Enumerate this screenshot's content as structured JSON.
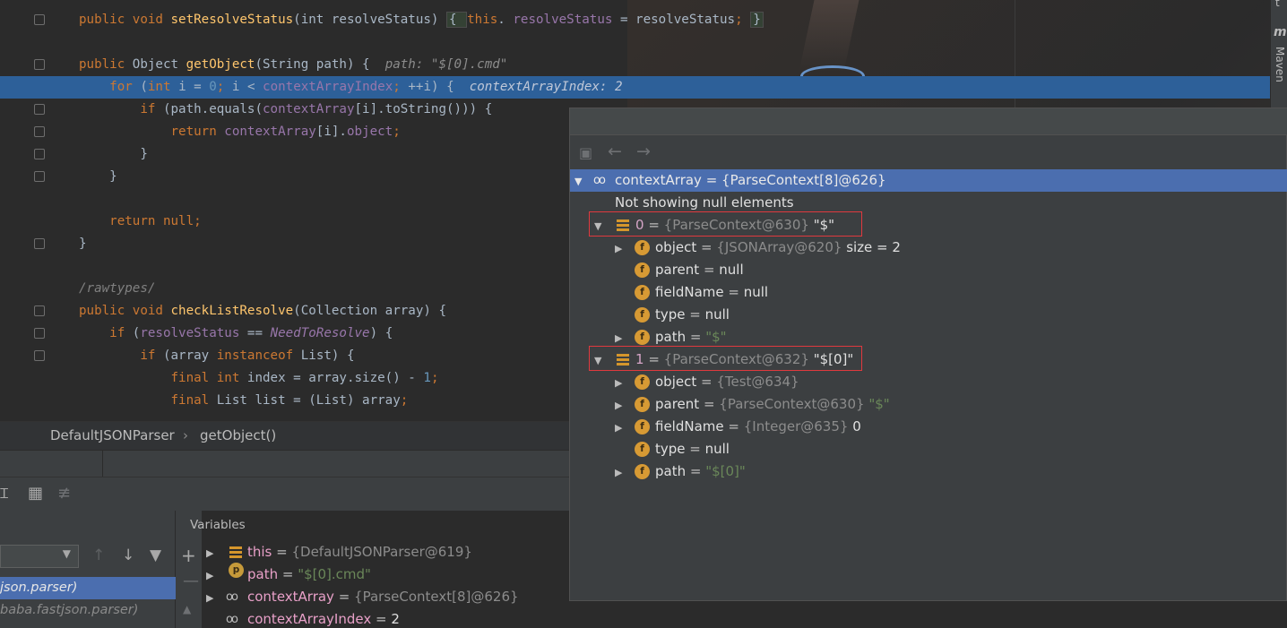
{
  "editor": {
    "lines": [
      {
        "id": "l1",
        "parts": [
          [
            "kw",
            "public void "
          ],
          [
            "fn",
            "setResolveStatus"
          ],
          [
            "",
            "(int resolveStatus) "
          ],
          [
            "annot",
            "{ "
          ],
          [
            "kw",
            "this"
          ],
          [
            "",
            ". "
          ],
          [
            "fld",
            "resolveStatus"
          ],
          [
            "",
            " = resolveStatus"
          ],
          [
            "kw",
            "; "
          ],
          [
            "annot",
            "}"
          ]
        ]
      },
      {
        "id": "l3",
        "parts": [
          [
            "kw",
            "public "
          ],
          [
            "",
            "Object "
          ],
          [
            "fn",
            "getObject"
          ],
          [
            "",
            "(String path) {  "
          ],
          [
            "hint",
            "path: \"$[0].cmd\""
          ]
        ]
      },
      {
        "id": "l4",
        "parts": [
          [
            "kw",
            "    for "
          ],
          [
            "",
            "("
          ],
          [
            "kw",
            "int "
          ],
          [
            "",
            "i = "
          ],
          [
            "num",
            "0"
          ],
          [
            "kw",
            "; "
          ],
          [
            "",
            "i < "
          ],
          [
            "fld",
            "contextArrayIndex"
          ],
          [
            "kw",
            "; "
          ],
          [
            "",
            "++i) {  "
          ],
          [
            "hint",
            "contextArrayIndex: 2"
          ]
        ]
      },
      {
        "id": "l5",
        "parts": [
          [
            "kw",
            "        if "
          ],
          [
            "",
            "(path.equals("
          ],
          [
            "fld",
            "contextArray"
          ],
          [
            "",
            "[i].toString())) {"
          ]
        ]
      },
      {
        "id": "l6",
        "parts": [
          [
            "kw",
            "            return "
          ],
          [
            "fld",
            "contextArray"
          ],
          [
            "",
            "[i]."
          ],
          [
            "fld",
            "object"
          ],
          [
            "kw",
            ";"
          ]
        ]
      },
      {
        "id": "l7",
        "parts": [
          [
            "",
            "        }"
          ]
        ]
      },
      {
        "id": "l8",
        "parts": [
          [
            "",
            "    }"
          ]
        ]
      },
      {
        "id": "l10",
        "parts": [
          [
            "kw",
            "    return null;"
          ]
        ]
      },
      {
        "id": "l11",
        "parts": [
          [
            "",
            "}"
          ]
        ]
      },
      {
        "id": "l13",
        "parts": [
          [
            "cm",
            "/rawtypes/"
          ]
        ]
      },
      {
        "id": "l14",
        "parts": [
          [
            "kw",
            "public void "
          ],
          [
            "fn",
            "checkListResolve"
          ],
          [
            "",
            "(Collection array) {"
          ]
        ]
      },
      {
        "id": "l15",
        "parts": [
          [
            "kw",
            "    if "
          ],
          [
            "",
            "("
          ],
          [
            "fld",
            "resolveStatus"
          ],
          [
            "",
            " == "
          ],
          [
            "st",
            "NeedToResolve"
          ],
          [
            "",
            ") {"
          ]
        ]
      },
      {
        "id": "l16",
        "parts": [
          [
            "kw",
            "        if "
          ],
          [
            "",
            "(array "
          ],
          [
            "kw",
            "instanceof "
          ],
          [
            "",
            "List) {"
          ]
        ]
      },
      {
        "id": "l17",
        "parts": [
          [
            "kw",
            "            final int "
          ],
          [
            "",
            "index = array.size() - "
          ],
          [
            "num",
            "1"
          ],
          [
            "kw",
            ";"
          ]
        ]
      },
      {
        "id": "l18",
        "parts": [
          [
            "kw",
            "            final "
          ],
          [
            "",
            "List list = (List) array"
          ],
          [
            "kw",
            ";"
          ]
        ]
      }
    ]
  },
  "breadcrumb": {
    "class_name": "DefaultJSONParser",
    "separator": "›",
    "method_name": "getObject()"
  },
  "frames": {
    "rows": [
      "json.parser)",
      "baba.fastjson.parser)"
    ]
  },
  "variables": {
    "title": "Variables",
    "rows": [
      {
        "name": "this",
        "value": "{DefaultJSONParser@619}"
      },
      {
        "name": "path",
        "value": "\"$[0].cmd\""
      },
      {
        "name": "contextArray",
        "value": "{ParseContext[8]@626}"
      },
      {
        "name": "contextArrayIndex",
        "value": "2"
      }
    ]
  },
  "popup": {
    "root": {
      "name": "contextArray",
      "value": "{ParseContext[8]@626}"
    },
    "note": "Not showing null elements",
    "elem0": {
      "index": "0",
      "obj": "{ParseContext@630}",
      "str": "\"$\""
    },
    "elem0_fields": [
      {
        "name": "object",
        "obj": "{JSONArray@620}",
        "extra": " size = 2"
      },
      {
        "name": "parent",
        "plain": "null"
      },
      {
        "name": "fieldName",
        "plain": "null"
      },
      {
        "name": "type",
        "plain": "null"
      },
      {
        "name": "path",
        "str": "\"$\""
      }
    ],
    "elem1": {
      "index": "1",
      "obj": "{ParseContext@632}",
      "str": "\"$[0]\""
    },
    "elem1_fields": [
      {
        "name": "object",
        "obj": "{Test@634}"
      },
      {
        "name": "parent",
        "obj": "{ParseContext@630}",
        "str": " \"$\""
      },
      {
        "name": "fieldName",
        "obj": "{Integer@635}",
        "plain": " 0"
      },
      {
        "name": "type",
        "plain": "null"
      },
      {
        "name": "path",
        "str": "\"$[0]\""
      }
    ]
  },
  "side_tabs": {
    "maven": "Maven",
    "m_icon": "m",
    "t": "t"
  },
  "colors": {
    "selection": "#4b6eaf",
    "line_highlight": "#2d6099",
    "keyword": "#cc7832",
    "red_box": "#e0393e"
  }
}
